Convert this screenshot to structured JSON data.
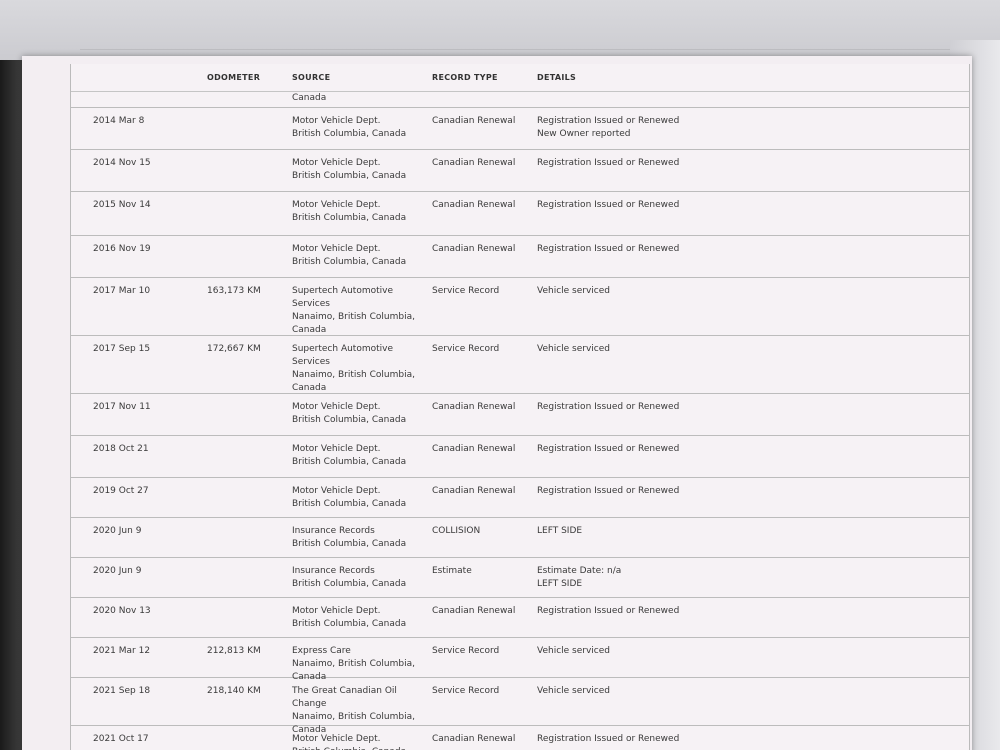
{
  "columns": {
    "odometer": "ODOMETER",
    "source": "SOURCE",
    "record_type": "RECORD TYPE",
    "details": "DETAILS"
  },
  "continued_source": "Canada",
  "records": [
    {
      "date": "2014 Mar 8",
      "odometer": "",
      "source": "Motor Vehicle Dept.\nBritish Columbia, Canada",
      "type": "Canadian Renewal",
      "details": "Registration Issued or Renewed\nNew Owner reported"
    },
    {
      "date": "2014 Nov 15",
      "odometer": "",
      "source": "Motor Vehicle Dept.\nBritish Columbia, Canada",
      "type": "Canadian Renewal",
      "details": "Registration Issued or Renewed"
    },
    {
      "date": "2015 Nov 14",
      "odometer": "",
      "source": "Motor Vehicle Dept.\nBritish Columbia, Canada",
      "type": "Canadian Renewal",
      "details": "Registration Issued or Renewed"
    },
    {
      "date": "2016 Nov 19",
      "odometer": "",
      "source": "Motor Vehicle Dept.\nBritish Columbia, Canada",
      "type": "Canadian Renewal",
      "details": "Registration Issued or Renewed"
    },
    {
      "date": "2017 Mar 10",
      "odometer": "163,173 KM",
      "source": "Supertech Automotive Services\nNanaimo, British Columbia,\nCanada",
      "type": "Service Record",
      "details": "Vehicle serviced"
    },
    {
      "date": "2017 Sep 15",
      "odometer": "172,667 KM",
      "source": "Supertech Automotive Services\nNanaimo, British Columbia,\nCanada",
      "type": "Service Record",
      "details": "Vehicle serviced"
    },
    {
      "date": "2017 Nov 11",
      "odometer": "",
      "source": "Motor Vehicle Dept.\nBritish Columbia, Canada",
      "type": "Canadian Renewal",
      "details": "Registration Issued or Renewed"
    },
    {
      "date": "2018 Oct 21",
      "odometer": "",
      "source": "Motor Vehicle Dept.\nBritish Columbia, Canada",
      "type": "Canadian Renewal",
      "details": "Registration Issued or Renewed"
    },
    {
      "date": "2019 Oct 27",
      "odometer": "",
      "source": "Motor Vehicle Dept.\nBritish Columbia, Canada",
      "type": "Canadian Renewal",
      "details": "Registration Issued or Renewed"
    },
    {
      "date": "2020 Jun 9",
      "odometer": "",
      "source": "Insurance Records\nBritish Columbia, Canada",
      "type": "COLLISION",
      "details": "LEFT SIDE"
    },
    {
      "date": "2020 Jun 9",
      "odometer": "",
      "source": "Insurance Records\nBritish Columbia, Canada",
      "type": "Estimate",
      "details": "Estimate Date: n/a\nLEFT SIDE"
    },
    {
      "date": "2020 Nov 13",
      "odometer": "",
      "source": "Motor Vehicle Dept.\nBritish Columbia, Canada",
      "type": "Canadian Renewal",
      "details": "Registration Issued or Renewed"
    },
    {
      "date": "2021 Mar 12",
      "odometer": "212,813 KM",
      "source": "Express Care\nNanaimo, British Columbia,\nCanada",
      "type": "Service Record",
      "details": "Vehicle serviced"
    },
    {
      "date": "2021 Sep 18",
      "odometer": "218,140 KM",
      "source": "The Great Canadian Oil\nChange\nNanaimo, British Columbia,\nCanada",
      "type": "Service Record",
      "details": "Vehicle serviced"
    },
    {
      "date": "2021 Oct 17",
      "odometer": "",
      "source": "Motor Vehicle Dept.\nBritish Columbia, Canada",
      "type": "Canadian Renewal",
      "details": "Registration Issued or Renewed"
    }
  ]
}
